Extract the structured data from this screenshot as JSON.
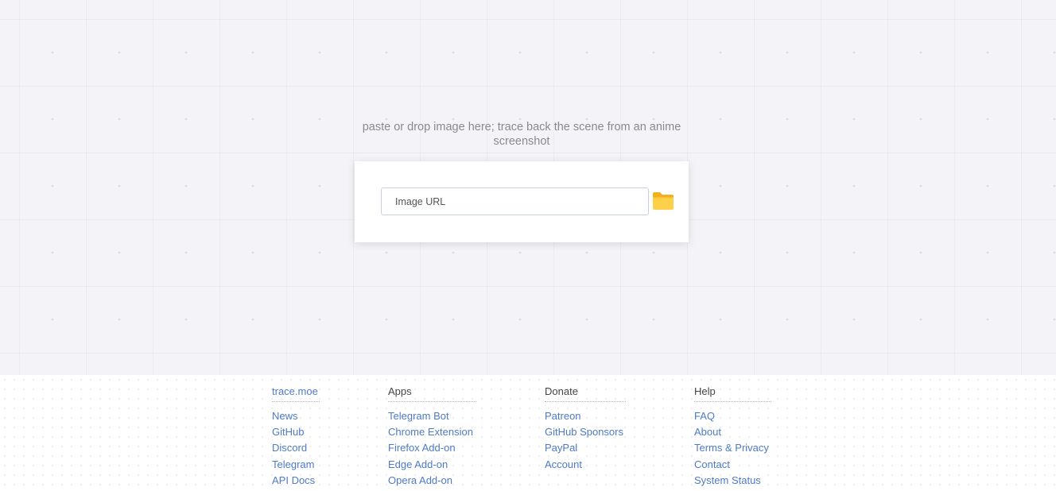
{
  "main": {
    "tagline": "paste or drop image here; trace back the scene from an anime screenshot",
    "url_input": {
      "placeholder": "Image URL",
      "value": ""
    },
    "folder_icon": "folder-icon",
    "colors": {
      "background": "#f4f4f8",
      "card": "#ffffff",
      "folder": "#fbc02d"
    }
  },
  "footer": {
    "link_color": "#4e7ac7",
    "columns": [
      {
        "heading": "trace.moe",
        "items": [
          "News",
          "GitHub",
          "Discord",
          "Telegram",
          "API Docs"
        ]
      },
      {
        "heading": "Apps",
        "items": [
          "Telegram Bot",
          "Chrome Extension",
          "Firefox Add-on",
          "Edge Add-on",
          "Opera Add-on"
        ]
      },
      {
        "heading": "Donate",
        "items": [
          "Patreon",
          "GitHub Sponsors",
          "PayPal",
          "Account"
        ]
      },
      {
        "heading": "Help",
        "items": [
          "FAQ",
          "About",
          "Terms & Privacy",
          "Contact",
          "System Status"
        ]
      }
    ]
  }
}
